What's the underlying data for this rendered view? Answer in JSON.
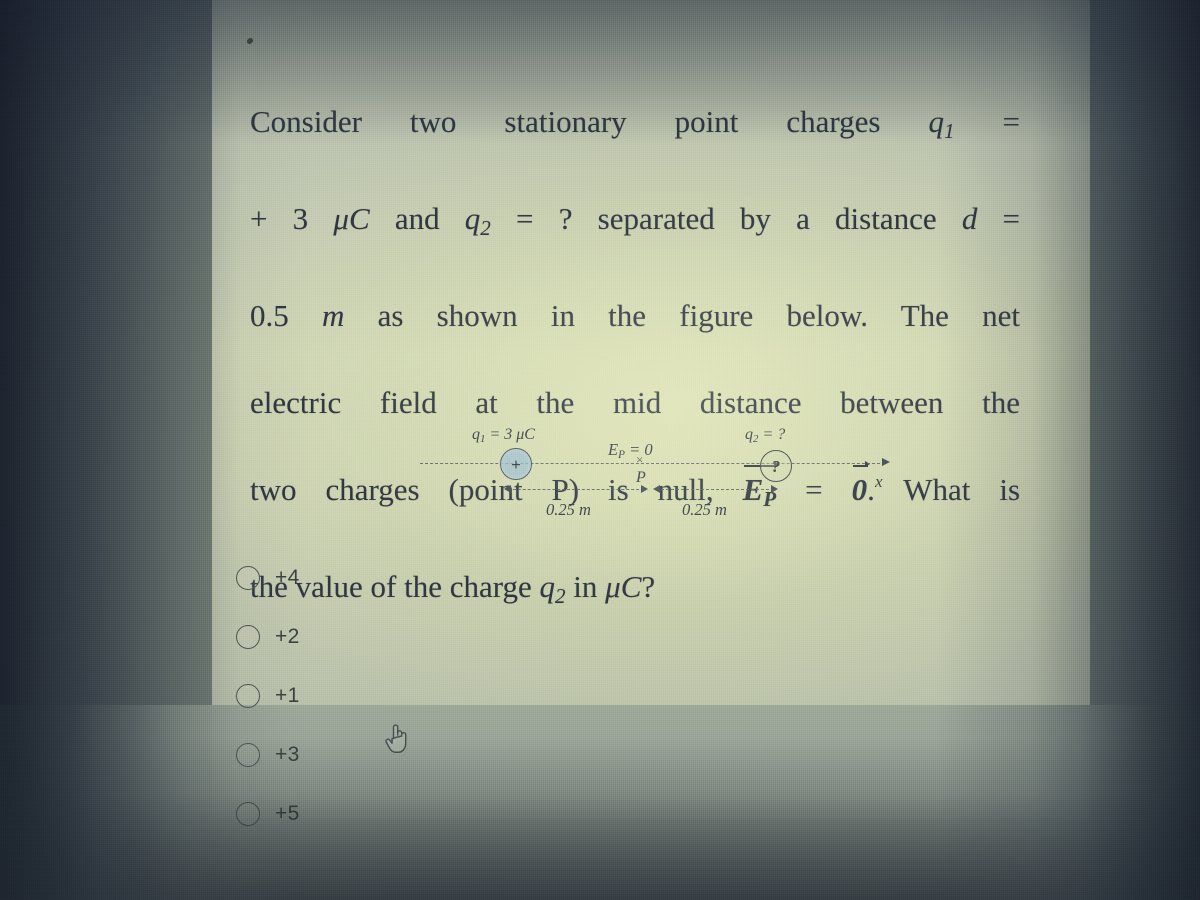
{
  "question": {
    "lines": [
      "Consider two stationary point charges q1 =",
      "+ 3 μC and q2 = ? separated by a distance d =",
      "0.5 m as shown in the figure below. The net",
      "electric field at the mid distance between the",
      "two charges (point P) is null, Ep = 0. What is",
      "the value of the charge q2 in μC?"
    ],
    "l1_a": "Consider two stationary point charges ",
    "l1_q": "q",
    "l1_sub": "1",
    "l1_eq": " =",
    "l2_a": "+ 3 ",
    "l2_mu": "μC",
    "l2_b": " and ",
    "l2_q": "q",
    "l2_sub": "2",
    "l2_c": " = ? separated by a distance ",
    "l2_d": "d",
    "l2_e": " =",
    "l3_a": "0.5 ",
    "l3_m": "m",
    "l3_b": " as shown in the figure below. The net",
    "l4": "electric field at the mid distance between the",
    "l5_a": "two charges (point P) is null, ",
    "l5_E": "E",
    "l5_sub": "P",
    "l5_eq": " = ",
    "l5_zero": "0",
    "l5_b": ". What is",
    "l6_a": "the value of the charge ",
    "l6_q": "q",
    "l6_sub": "2",
    "l6_b": " in ",
    "l6_mu": "μC",
    "l6_c": "?"
  },
  "figure": {
    "q1_label_q": "q",
    "q1_label_sub": "1",
    "q1_label_rest": " = 3 μC",
    "q1_symbol": "+",
    "q2_label_q": "q",
    "q2_label_sub": "2",
    "q2_label_rest": " = ?",
    "q2_symbol": "?",
    "ep_E": "E",
    "ep_sub": "P",
    "ep_rest": " = 0",
    "p_mark": "×",
    "p_label": "P",
    "dim_left": "0.25 m",
    "dim_right": "0.25 m",
    "axis_label": "x",
    "colors": {
      "q1_fill": "#96b9d2",
      "ink": "#2f3a42"
    }
  },
  "options": [
    {
      "label": "+4",
      "selected": false
    },
    {
      "label": "+2",
      "selected": false
    },
    {
      "label": "+1",
      "selected": false
    },
    {
      "label": "+3",
      "selected": false
    },
    {
      "label": "+5",
      "selected": false
    }
  ],
  "cursor": {
    "icon": "pointing-hand-cursor"
  },
  "page_colors": {
    "paper_light": "#cfd5b6",
    "paper_gray": "#9ba598",
    "background": "#55606a"
  }
}
